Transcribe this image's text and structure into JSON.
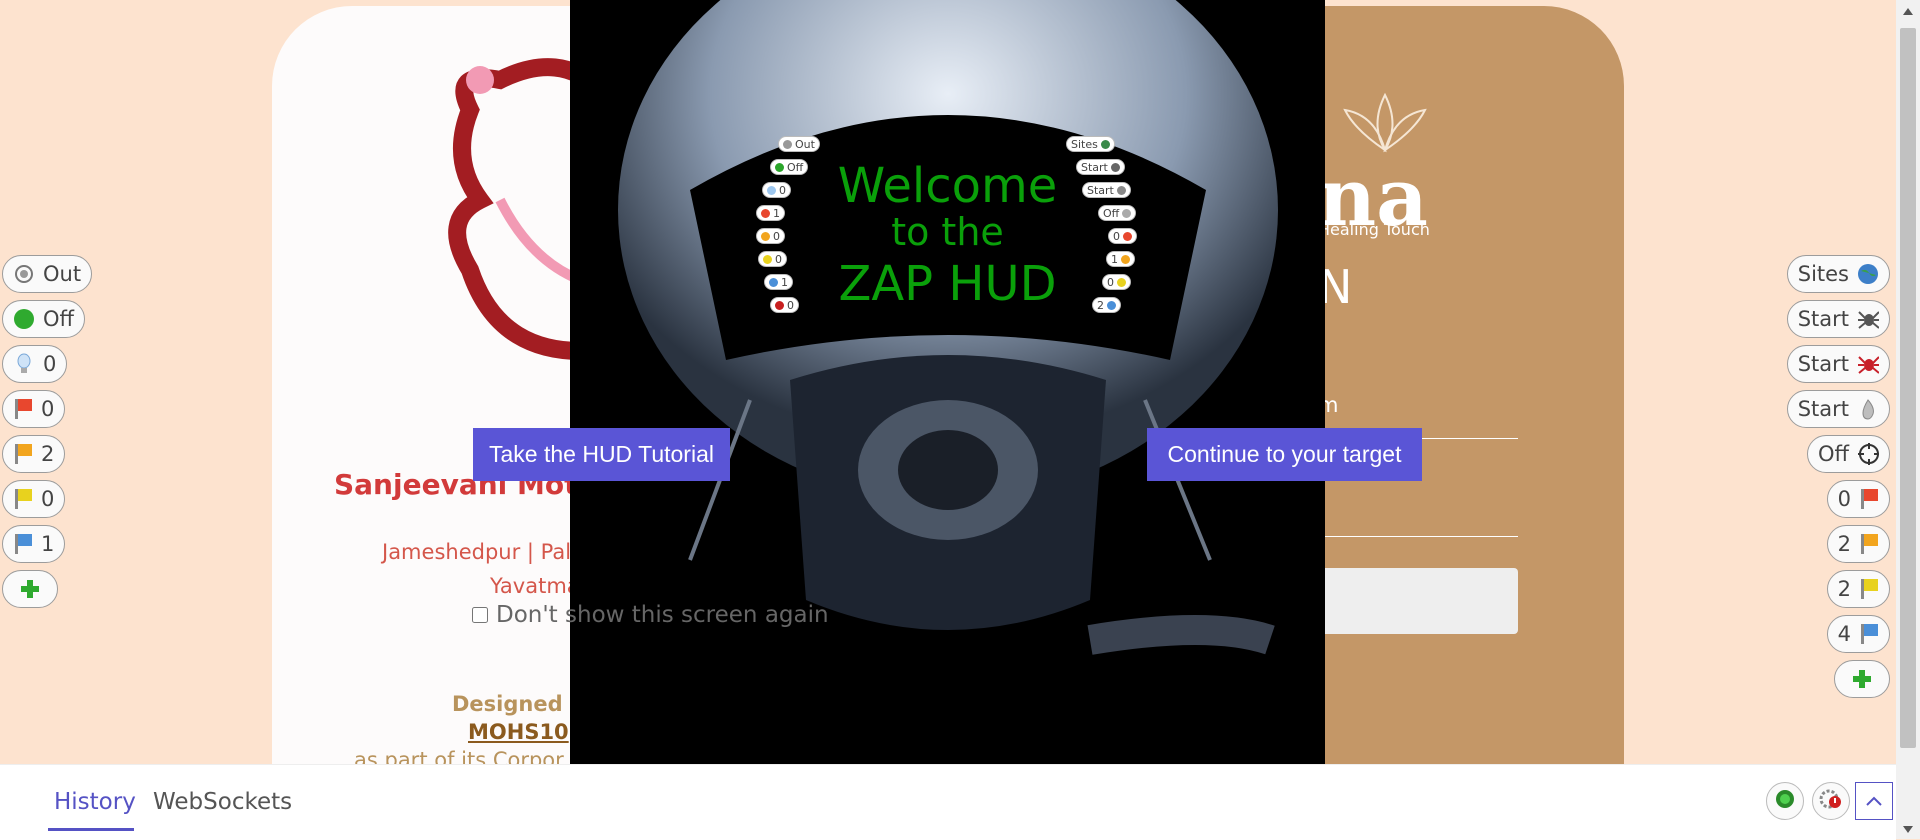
{
  "target_page": {
    "hospital_name": "Sanjeevani Moth",
    "locations": "Jameshedpur | Pal",
    "city": "Yavatma",
    "designed_by": "Designed &",
    "designer": "MOHS10",
    "corporate_line": "as part of its Corpor",
    "brand_name": "na",
    "brand_tagline": "Healing Touch",
    "login_heading": "N",
    "email_fragment": "m"
  },
  "splash": {
    "welcome_line1": "Welcome",
    "welcome_line2": "to the",
    "welcome_line3": "ZAP HUD",
    "tutorial_button": "Take the HUD Tutorial",
    "continue_button": "Continue to your target",
    "dont_show_label": "Don't show this screen again",
    "mini_left": [
      "Out",
      "Off",
      "0",
      "1",
      "0",
      "0",
      "1",
      "0"
    ],
    "mini_right": [
      "Sites",
      "Start",
      "Start",
      "Off",
      "0",
      "1",
      "0",
      "2"
    ]
  },
  "left_panel": [
    {
      "label": "Out",
      "icon": "target-icon"
    },
    {
      "label": "Off",
      "icon": "green-circle-icon"
    },
    {
      "label": "0",
      "icon": "lightbulb-icon"
    },
    {
      "label": "0",
      "icon": "red-flag-icon",
      "color": "#e8472e"
    },
    {
      "label": "2",
      "icon": "orange-flag-icon",
      "color": "#f2a51e"
    },
    {
      "label": "0",
      "icon": "yellow-flag-icon",
      "color": "#e8d21e"
    },
    {
      "label": "1",
      "icon": "blue-flag-icon",
      "color": "#4a8fd8"
    }
  ],
  "right_panel": [
    {
      "label": "Sites",
      "icon": "globe-icon"
    },
    {
      "label": "Start",
      "icon": "spider-icon"
    },
    {
      "label": "Start",
      "icon": "ajax-spider-icon"
    },
    {
      "label": "Start",
      "icon": "flame-icon"
    },
    {
      "label": "Off",
      "icon": "crosshair-icon"
    },
    {
      "label": "0",
      "icon": "red-flag-icon",
      "color": "#e8472e"
    },
    {
      "label": "2",
      "icon": "orange-flag-icon",
      "color": "#f2a51e"
    },
    {
      "label": "2",
      "icon": "yellow-flag-icon",
      "color": "#e8d21e"
    },
    {
      "label": "4",
      "icon": "blue-flag-icon",
      "color": "#4a8fd8"
    }
  ],
  "bottom_drawer": {
    "tabs": [
      "History",
      "WebSockets"
    ]
  }
}
